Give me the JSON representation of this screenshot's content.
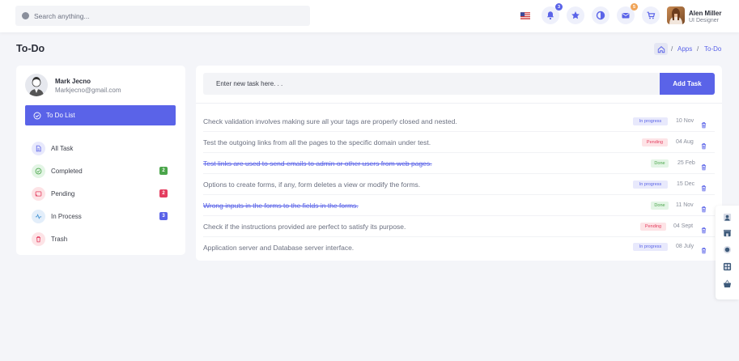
{
  "header": {
    "search_placeholder": "Search anything...",
    "notification_count": "3",
    "mail_count": "5",
    "user_name": "Alen Miller",
    "user_role": "UI Designer"
  },
  "page": {
    "title": "To-Do",
    "breadcrumb": {
      "apps": "Apps",
      "separator": "/",
      "current": "To-Do"
    }
  },
  "profile": {
    "name": "Mark Jecno",
    "email": "Markjecno@gmail.com"
  },
  "sidebar": {
    "todo_button": "To Do List",
    "items": [
      {
        "label": "All Task",
        "count": "",
        "icon": "file-icon",
        "color": "#5a63e8"
      },
      {
        "label": "Completed",
        "count": "2",
        "icon": "check-circle-icon",
        "color": "#4aa54a"
      },
      {
        "label": "Pending",
        "count": "2",
        "icon": "cast-icon",
        "color": "#e43d5f"
      },
      {
        "label": "In Process",
        "count": "3",
        "icon": "activity-icon",
        "color": "#3e91d1"
      },
      {
        "label": "Trash",
        "count": "",
        "icon": "trash-icon",
        "color": "#e43d5f"
      }
    ]
  },
  "tasks": {
    "input_placeholder": "Enter new task here. . .",
    "add_button": "Add Task",
    "rows": [
      {
        "text": "Check validation involves making sure all your tags are properly closed and nested.",
        "status": "In progress",
        "date": "10 Nov",
        "done": false
      },
      {
        "text": "Test the outgoing links from all the pages to the specific domain under test.",
        "status": "Pending",
        "date": "04 Aug",
        "done": false
      },
      {
        "text": "Test links are used to send emails to admin or other users from web pages.",
        "status": "Done",
        "date": "25 Feb",
        "done": true
      },
      {
        "text": "Options to create forms, if any, form deletes a view or modify the forms.",
        "status": "In progress",
        "date": "15 Dec",
        "done": false
      },
      {
        "text": "Wrong inputs in the forms to the fields in the forms.",
        "status": "Done",
        "date": "11 Nov",
        "done": true
      },
      {
        "text": "Check if the instructions provided are perfect to satisfy its purpose.",
        "status": "Pending",
        "date": "04 Sept",
        "done": false
      },
      {
        "text": "Application server and Database server interface.",
        "status": "In progress",
        "date": "08 July",
        "done": false
      }
    ]
  },
  "colors": {
    "primary": "#5a63e8",
    "in_progress_bg": "#e8e9fc",
    "pending_bg": "#fde3e6",
    "done_bg": "#e3f5e5"
  }
}
